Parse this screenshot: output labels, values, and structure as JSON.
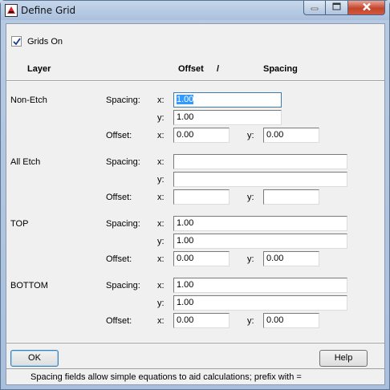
{
  "window": {
    "title": "Define Grid",
    "controls": {
      "minimize_icon": "minimize-icon",
      "maximize_icon": "maximize-icon",
      "close_icon": "close-icon"
    },
    "close_color": "#c4442b"
  },
  "grids_on": {
    "label": "Grids On",
    "checked": true
  },
  "headers": {
    "layer": "Layer",
    "offset": "Offset",
    "slash": "/",
    "spacing": "Spacing"
  },
  "labels": {
    "spacing": "Spacing:",
    "offset": "Offset:",
    "x": "x:",
    "y": "y:"
  },
  "layers": [
    {
      "name": "Non-Etch",
      "spacing_x": "1.00",
      "spacing_y": "1.00",
      "offset_x": "0.00",
      "offset_y": "0.00"
    },
    {
      "name": "All Etch",
      "spacing_x": "",
      "spacing_y": "",
      "offset_x": "",
      "offset_y": ""
    },
    {
      "name": "TOP",
      "spacing_x": "1.00",
      "spacing_y": "1.00",
      "offset_x": "0.00",
      "offset_y": "0.00"
    },
    {
      "name": "BOTTOM",
      "spacing_x": "1.00",
      "spacing_y": "1.00",
      "offset_x": "0.00",
      "offset_y": "0.00"
    }
  ],
  "buttons": {
    "ok": "OK",
    "help": "Help"
  },
  "status_text": "Spacing fields allow simple equations to aid calculations; prefix with =",
  "accent_color": "#3399ff"
}
